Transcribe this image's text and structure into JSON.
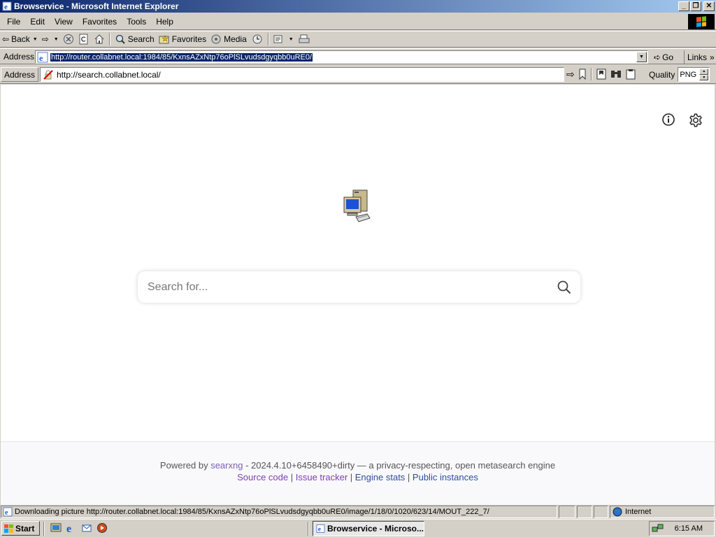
{
  "window": {
    "title": "Browservice - Microsoft Internet Explorer"
  },
  "menu": [
    "File",
    "Edit",
    "View",
    "Favorites",
    "Tools",
    "Help"
  ],
  "toolbar": {
    "back": "Back",
    "search": "Search",
    "favorites": "Favorites",
    "media": "Media"
  },
  "address": {
    "label": "Address",
    "url": "http://router.collabnet.local:1984/85/KxnsAZxNtp76oPlSLvudsdgyqbb0uRE0/",
    "go": "Go",
    "links": "Links"
  },
  "inner_address": {
    "label": "Address",
    "url": "http://search.collabnet.local/",
    "quality_label": "Quality",
    "quality_value": "PNG"
  },
  "page": {
    "search_placeholder": "Search for...",
    "footer_powered": "Powered by",
    "footer_link": "searxng",
    "footer_rest": " - 2024.4.10+6458490+dirty — a privacy-respecting, open metasearch engine",
    "footer_links": [
      "Source code",
      "Issue tracker",
      "Engine stats",
      "Public instances"
    ]
  },
  "status": {
    "text": "Downloading picture http://router.collabnet.local:1984/85/KxnsAZxNtp76oPlSLvudsdgyqbb0uRE0/image/1/18/0/1020/623/14/MOUT_222_7/",
    "zone": "Internet"
  },
  "taskbar": {
    "start": "Start",
    "task": "Browservice - Microso...",
    "clock": "6:15 AM"
  }
}
